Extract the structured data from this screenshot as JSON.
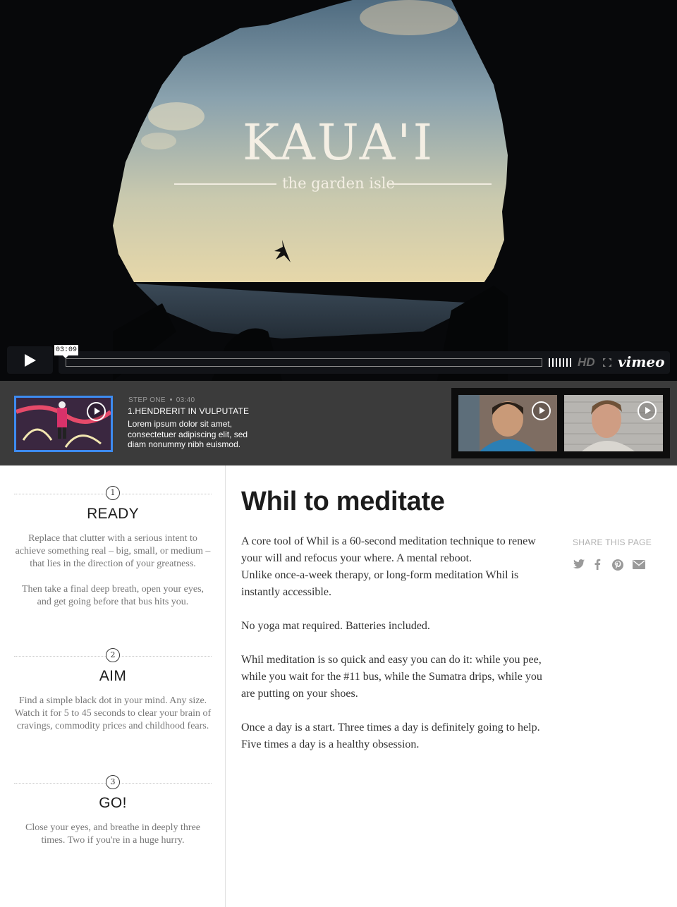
{
  "video": {
    "title": "KAUA'I",
    "subtitle": "the garden isle",
    "current_time": "03:09",
    "hd_label": "HD",
    "brand": "vimeo"
  },
  "playlist": {
    "active": {
      "step_label": "STEP ONE",
      "duration": "03:40",
      "title": "1.HENDRERIT IN VULPUTATE",
      "description": "Lorem ipsum dolor sit amet, consectetuer adipiscing elit, sed diam nonummy nibh euismod."
    }
  },
  "steps": [
    {
      "number": "1",
      "title": "READY",
      "paragraphs": [
        "Replace that clutter with a serious intent to achieve something real – big, small, or medium – that lies in the direction of your greatness.",
        "Then take a final deep breath, open your eyes, and get going before that bus hits you."
      ]
    },
    {
      "number": "2",
      "title": "AIM",
      "paragraphs": [
        "Find a simple black dot in your mind. Any size. Watch it for 5 to 45 seconds to clear your brain of cravings, commodity prices and childhood fears."
      ]
    },
    {
      "number": "3",
      "title": "GO!",
      "paragraphs": [
        "Close your eyes, and breathe in deeply three times. Two if you're in a huge hurry."
      ]
    }
  ],
  "main": {
    "title": "Whil to meditate",
    "p1a": "A core tool of Whil is a 60-second meditation technique to renew your will and refocus your where. A mental reboot.",
    "p1b": "Unlike once-a-week therapy, or long-form meditation Whil is instantly accessible.",
    "p2": "No yoga mat required. Batteries included.",
    "p3": "Whil meditation is so quick and easy you can do it: while you pee, while you wait for the #11 bus, while the Sumatra drips, while you are putting on your shoes.",
    "p4": "Once a day is a start. Three times a day is definitely going to help. Five times a day is a healthy obsession."
  },
  "share": {
    "label": "SHARE THIS PAGE",
    "icons": [
      "twitter-icon",
      "facebook-icon",
      "pinterest-icon",
      "email-icon"
    ]
  },
  "colors": {
    "accent_blue": "#3d8bf0",
    "strip_bg": "#3b3b3b",
    "hero_bg": "#07080a"
  }
}
